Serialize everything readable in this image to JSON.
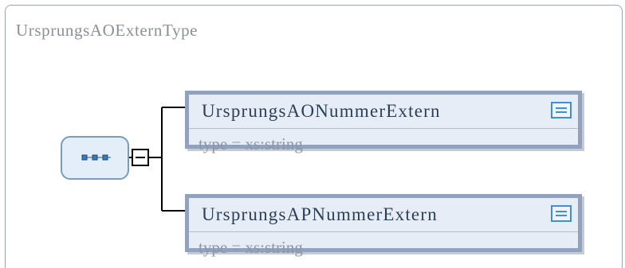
{
  "diagram": {
    "title": "UrsprungsAOExternType",
    "compositor": {
      "kind": "sequence",
      "icon": "sequence-icon",
      "collapse_icon": "minus-icon"
    },
    "elements": [
      {
        "name": "UrsprungsAONummerExtern",
        "type_label": "type = xs:string",
        "icon": "documentation-icon"
      },
      {
        "name": "UrsprungsAPNummerExtern",
        "type_label": "type = xs:string",
        "icon": "documentation-icon"
      }
    ],
    "colors": {
      "element_fill": "#e6edf7",
      "element_border": "#92a2bd",
      "compositor_fill": "#e3eef9",
      "compositor_border": "#7b9bbb",
      "doc_icon": "#3f8ed7",
      "connector": "#000000"
    }
  }
}
